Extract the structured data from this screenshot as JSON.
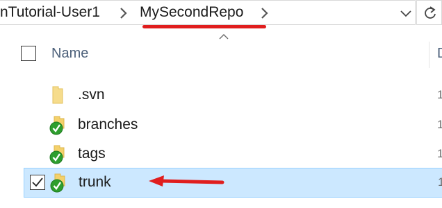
{
  "address_bar": {
    "crumb_parent": "nTutorial-User1",
    "crumb_current": "MySecondRepo"
  },
  "list": {
    "column_name": "Name",
    "column_date_partial": "D",
    "sort": "ascending",
    "items": [
      {
        "name": ".svn",
        "icon": "plain-folder-icon",
        "status": "none",
        "selected": false,
        "date_partial": "1"
      },
      {
        "name": "branches",
        "icon": "svn-normal-folder-icon",
        "status": "normal",
        "selected": false,
        "date_partial": "1"
      },
      {
        "name": "tags",
        "icon": "svn-normal-folder-icon",
        "status": "normal",
        "selected": false,
        "date_partial": "1"
      },
      {
        "name": "trunk",
        "icon": "svn-normal-folder-icon",
        "status": "normal",
        "selected": true,
        "date_partial": "1"
      }
    ]
  },
  "colors": {
    "selection_bg": "#cce8ff",
    "selection_border": "#99d1ff",
    "annotation_red": "#e01e1e",
    "svn_ok_green": "#2e9e2e",
    "folder_yellow": "#f4d16b"
  }
}
